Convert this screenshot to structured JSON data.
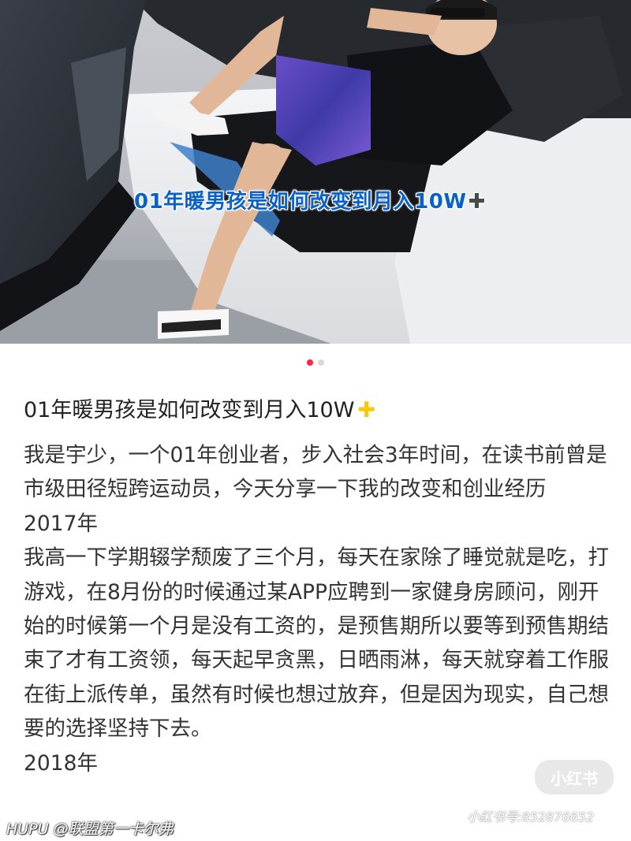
{
  "hero": {
    "overlay_title": "01年暖男孩是如何改变到月入10W",
    "overlay_plus": "✚"
  },
  "carousel": {
    "count": 2,
    "active_index": 0
  },
  "note": {
    "title": "01年暖男孩是如何改变到月入10W",
    "title_emoji": "✚",
    "paragraphs": [
      "我是宇少，一个01年创业者，步入社会3年时间，在读书前曾是市级田径短跨运动员，今天分享一下我的改变和创业经历",
      "2017年",
      "我高一下学期辍学颓废了三个月，每天在家除了睡觉就是吃，打游戏，在8月份的时候通过某APP应聘到一家健身房顾问，刚开始的时候第一个月是没有工资的，是预售期所以要等到预售期结束了才有工资领，每天起早贪黑，日晒雨淋，每天就穿着工作服在街上派传单，虽然有时候也想过放弃，但是因为现实，自己想要的选择坚持下去。",
      "2018年"
    ]
  },
  "watermarks": {
    "handle": "HUPU @联盟第一卡尔弗",
    "logo": "小红书",
    "id": "小红书号:852876652"
  },
  "colors": {
    "accent": "#ff2442",
    "overlay_text": "#0a62c8"
  }
}
